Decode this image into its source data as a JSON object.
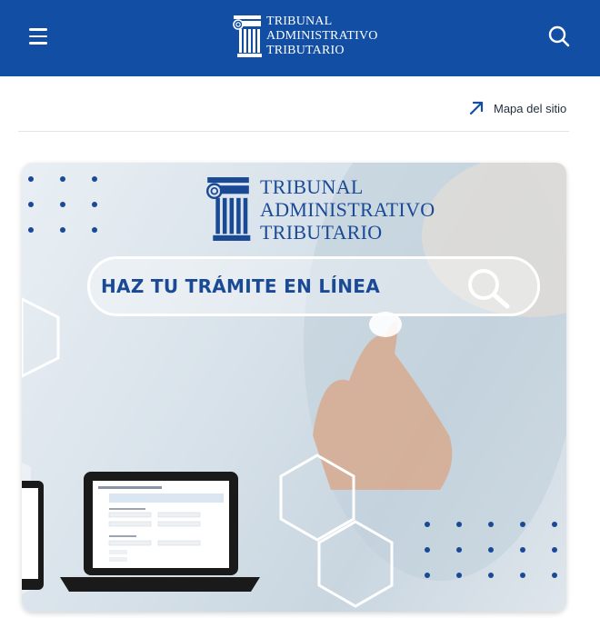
{
  "header": {
    "logo": {
      "line1": "TRIBUNAL",
      "line2": "ADMINISTRATIVO",
      "line3": "TRIBUTARIO",
      "icon": "ionic-column-logo"
    },
    "menu_icon": "hamburger-menu-icon",
    "search_icon": "search-icon",
    "background_color": "#114ea4"
  },
  "utility": {
    "sitemap_label": "Mapa del sitio",
    "sitemap_icon": "arrow-up-right-icon"
  },
  "banner": {
    "logo": {
      "line1": "TRIBUNAL",
      "line2": "ADMINISTRATIVO",
      "line3": "TRIBUTARIO"
    },
    "headline": "HAZ TU TRÁMITE EN LÍNEA",
    "accent_color": "#1a4a95"
  }
}
